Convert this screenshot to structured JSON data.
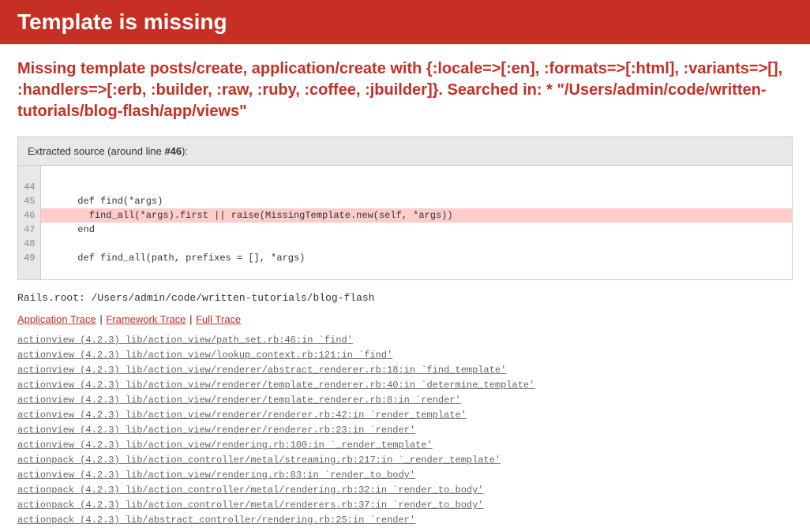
{
  "header": {
    "title": "Template is missing"
  },
  "error": {
    "message": "Missing template posts/create, application/create with {:locale=>[:en], :formats=>[:html], :variants=>[], :handlers=>[:erb, :builder, :raw, :ruby, :coffee, :jbuilder]}. Searched in: * \"/Users/admin/code/written-tutorials/blog-flash/app/views\""
  },
  "source": {
    "header_prefix": "Extracted source (around line ",
    "header_line": "#46",
    "header_suffix": "):",
    "lines": [
      {
        "num": "44",
        "code": "",
        "hl": false
      },
      {
        "num": "45",
        "code": "    def find(*args)",
        "hl": false
      },
      {
        "num": "46",
        "code": "      find_all(*args).first || raise(MissingTemplate.new(self, *args))",
        "hl": true
      },
      {
        "num": "47",
        "code": "    end",
        "hl": false
      },
      {
        "num": "48",
        "code": "",
        "hl": false
      },
      {
        "num": "49",
        "code": "    def find_all(path, prefixes = [], *args)",
        "hl": false
      }
    ]
  },
  "rails_root": "Rails.root: /Users/admin/code/written-tutorials/blog-flash",
  "trace_nav": {
    "application": "Application Trace",
    "framework": "Framework Trace",
    "full": "Full Trace",
    "sep": " | "
  },
  "trace": [
    "actionview (4.2.3) lib/action_view/path_set.rb:46:in `find'",
    "actionview (4.2.3) lib/action_view/lookup_context.rb:121:in `find'",
    "actionview (4.2.3) lib/action_view/renderer/abstract_renderer.rb:18:in `find_template'",
    "actionview (4.2.3) lib/action_view/renderer/template_renderer.rb:40:in `determine_template'",
    "actionview (4.2.3) lib/action_view/renderer/template_renderer.rb:8:in `render'",
    "actionview (4.2.3) lib/action_view/renderer/renderer.rb:42:in `render_template'",
    "actionview (4.2.3) lib/action_view/renderer/renderer.rb:23:in `render'",
    "actionview (4.2.3) lib/action_view/rendering.rb:100:in `_render_template'",
    "actionpack (4.2.3) lib/action_controller/metal/streaming.rb:217:in `_render_template'",
    "actionview (4.2.3) lib/action_view/rendering.rb:83:in `render_to_body'",
    "actionpack (4.2.3) lib/action_controller/metal/rendering.rb:32:in `render_to_body'",
    "actionpack (4.2.3) lib/action_controller/metal/renderers.rb:37:in `render_to_body'",
    "actionpack (4.2.3) lib/abstract_controller/rendering.rb:25:in `render'"
  ]
}
